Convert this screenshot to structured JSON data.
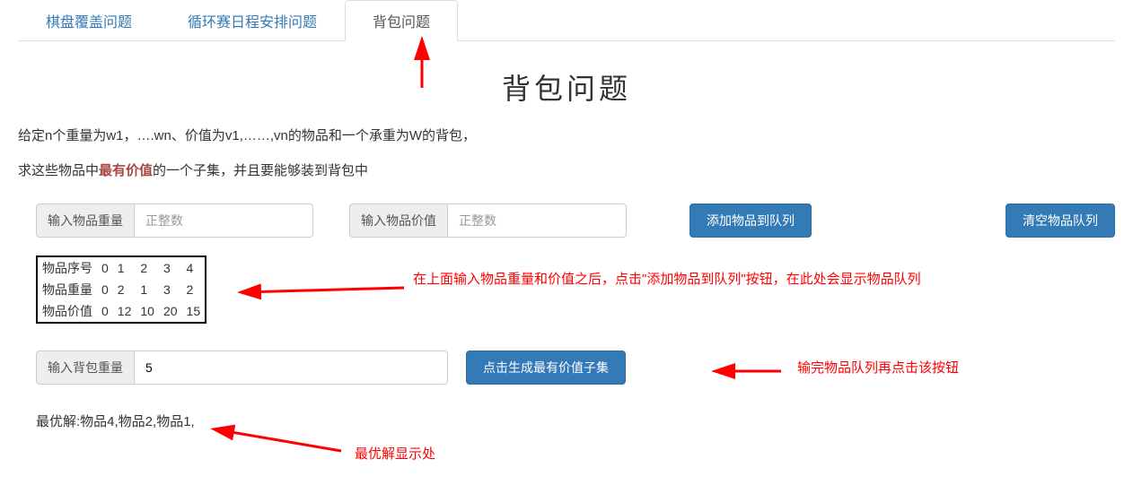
{
  "tabs": [
    {
      "label": "棋盘覆盖问题",
      "active": false
    },
    {
      "label": "循环赛日程安排问题",
      "active": false
    },
    {
      "label": "背包问题",
      "active": true
    }
  ],
  "heading": "背包问题",
  "desc": {
    "line1": "给定n个重量为w1，….wn、价值为v1,……,vn的物品和一个承重为W的背包，",
    "line2_before": "求这些物品中",
    "line2_emph": "最有价值",
    "line2_after": "的一个子集，并且要能够装到背包中"
  },
  "inputs": {
    "weight_label": "输入物品重量",
    "weight_placeholder": "正整数",
    "value_label": "输入物品价值",
    "value_placeholder": "正整数",
    "capacity_label": "输入背包重量",
    "capacity_value": "5"
  },
  "buttons": {
    "add": "添加物品到队列",
    "clear": "清空物品队列",
    "generate": "点击生成最有价值子集"
  },
  "table": {
    "row_labels": [
      "物品序号",
      "物品重量",
      "物品价值"
    ],
    "columns": [
      "0",
      "1",
      "2",
      "3",
      "4"
    ],
    "rows": [
      [
        "0",
        "1",
        "2",
        "3",
        "4"
      ],
      [
        "0",
        "2",
        "1",
        "3",
        "2"
      ],
      [
        "0",
        "12",
        "10",
        "20",
        "15"
      ]
    ]
  },
  "result": {
    "prefix": "最优解:",
    "value": "物品4,物品2,物品1,"
  },
  "annotations": {
    "queue_hint": "在上面输入物品重量和价值之后，点击\"添加物品到队列\"按钮，在此处会显示物品队列",
    "generate_hint": "输完物品队列再点击该按钮",
    "result_hint": "最优解显示处"
  }
}
